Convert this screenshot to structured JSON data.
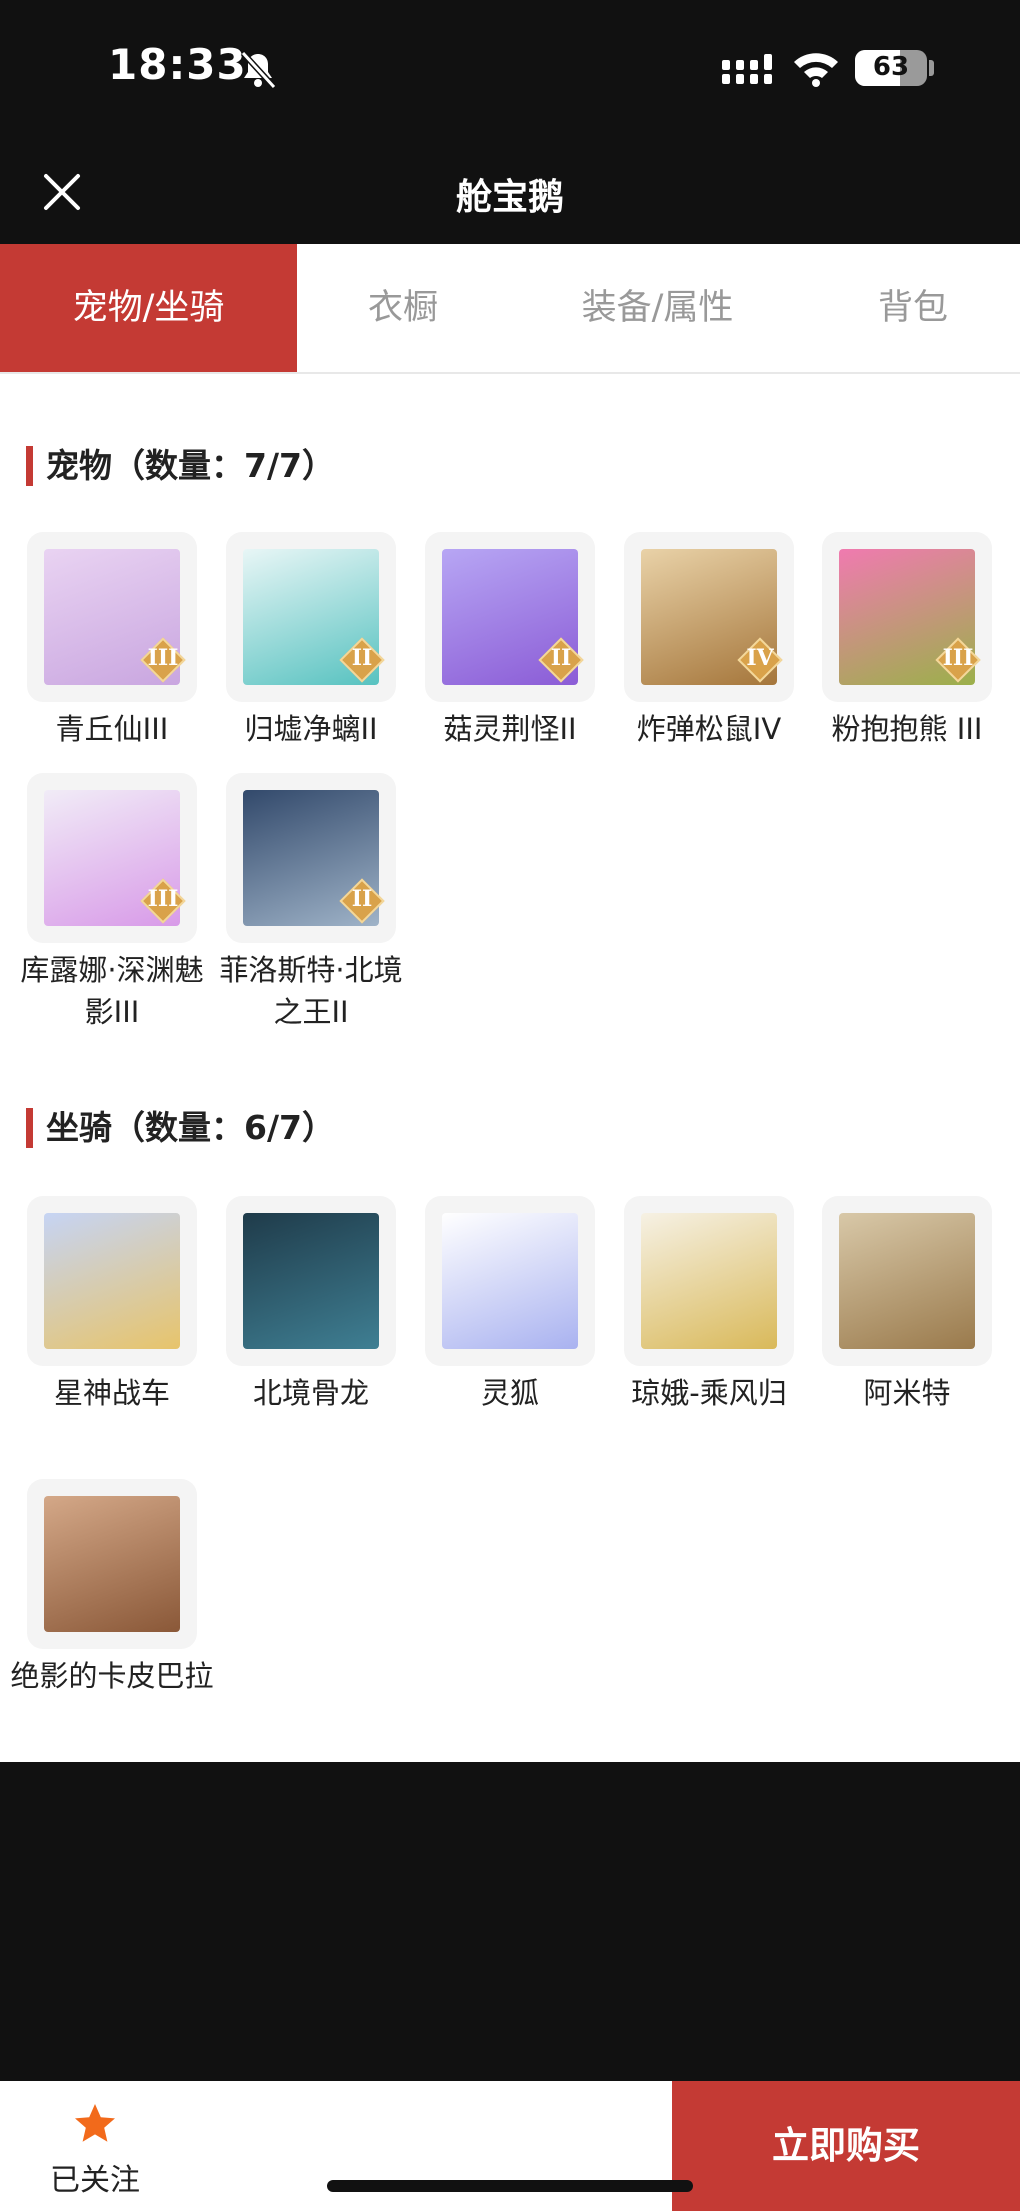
{
  "status_bar": {
    "time": "18:33",
    "battery": "63",
    "battery_level_pct": 63,
    "icons": [
      "bell-muted-icon",
      "signal-icon",
      "wifi-icon",
      "battery-icon"
    ]
  },
  "nav": {
    "title": "舱宝鹅",
    "close_icon": "close-icon"
  },
  "tabs": [
    {
      "label": "宠物/坐骑",
      "active": true
    },
    {
      "label": "衣橱",
      "active": false
    },
    {
      "label": "装备/属性",
      "active": false
    },
    {
      "label": "背包",
      "active": false
    }
  ],
  "sections": [
    {
      "title": "宠物（数量：7/7）",
      "items": [
        {
          "label": "青丘仙III",
          "badge": "III",
          "colors": [
            "#e9d3f2",
            "#c9a6e0"
          ]
        },
        {
          "label": "归墟净螭II",
          "badge": "II",
          "colors": [
            "#e8f6f6",
            "#57c2c0"
          ]
        },
        {
          "label": "菇灵荆怪II",
          "badge": "II",
          "colors": [
            "#b7a6f4",
            "#8b5cd6"
          ]
        },
        {
          "label": "炸弹松鼠IV",
          "badge": "IV",
          "colors": [
            "#e9d2a8",
            "#a5763b"
          ]
        },
        {
          "label": "粉抱抱熊 III",
          "badge": "III",
          "colors": [
            "#f07ab0",
            "#9bb04a"
          ]
        },
        {
          "label": "库露娜·深渊魅影III",
          "badge": "III",
          "colors": [
            "#f1ecf7",
            "#d89ae8"
          ]
        },
        {
          "label": "菲洛斯特·北境之王II",
          "badge": "II",
          "colors": [
            "#32496b",
            "#9fb3c8"
          ]
        }
      ]
    },
    {
      "title": "坐骑（数量：6/7）",
      "items": [
        {
          "label": "星神战车",
          "badge": "",
          "colors": [
            "#c6d4f4",
            "#e7c46b"
          ]
        },
        {
          "label": "北境骨龙",
          "badge": "",
          "colors": [
            "#1f3b4a",
            "#3f7f93"
          ]
        },
        {
          "label": "灵狐",
          "badge": "",
          "colors": [
            "#ffffff",
            "#a9b2f0"
          ]
        },
        {
          "label": "琼娥-乘风归",
          "badge": "",
          "colors": [
            "#f6f1e4",
            "#d9b95a"
          ]
        },
        {
          "label": "阿米特",
          "badge": "",
          "colors": [
            "#d8c8a8",
            "#9a7a4c"
          ]
        },
        {
          "label": "绝影的卡皮巴拉",
          "badge": "",
          "colors": [
            "#d4a888",
            "#8a5838"
          ]
        }
      ]
    }
  ],
  "bottom": {
    "follow_label": "已关注",
    "buy_label": "立即购买",
    "accent": "#c43a34",
    "star_color": "#f26a1b"
  }
}
